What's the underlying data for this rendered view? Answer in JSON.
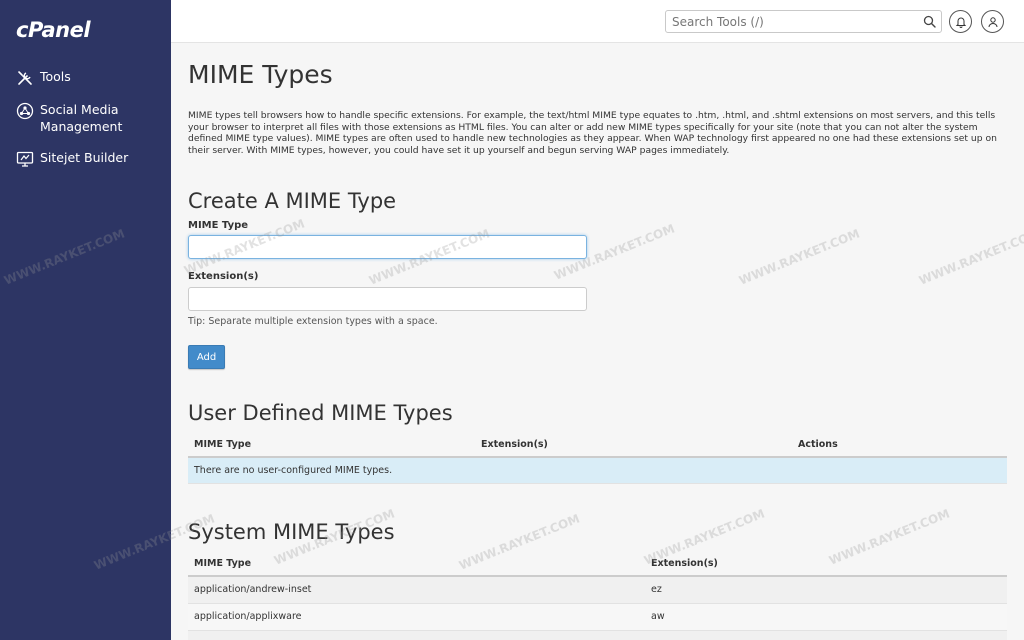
{
  "brand": {
    "logo_text": "cPanel"
  },
  "sidebar": {
    "items": [
      {
        "label": "Tools",
        "icon": "tools-icon"
      },
      {
        "label": "Social Media Management",
        "icon": "social-media-icon"
      },
      {
        "label": "Sitejet Builder",
        "icon": "sitejet-icon"
      }
    ]
  },
  "topbar": {
    "search_placeholder": "Search Tools (/)"
  },
  "page": {
    "title": "MIME Types",
    "description": "MIME types tell browsers how to handle specific extensions. For example, the text/html MIME type equates to .htm, .html, and .shtml extensions on most servers, and this tells your browser to interpret all files with those extensions as HTML files. You can alter or add new MIME types specifically for your site (note that you can not alter the system defined MIME type values). MIME types are often used to handle new technologies as they appear. When WAP technology first appeared no one had these extensions set up on their server. With MIME types, however, you could have set it up yourself and begun serving WAP pages immediately."
  },
  "create": {
    "heading": "Create A MIME Type",
    "mime_label": "MIME Type",
    "mime_value": "",
    "ext_label": "Extension(s)",
    "ext_value": "",
    "tip": "Tip: Separate multiple extension types with a space.",
    "add_label": "Add"
  },
  "user_defined": {
    "heading": "User Defined MIME Types",
    "columns": [
      "MIME Type",
      "Extension(s)",
      "Actions"
    ],
    "empty_message": "There are no user-configured MIME types."
  },
  "system": {
    "heading": "System MIME Types",
    "columns": [
      "MIME Type",
      "Extension(s)"
    ],
    "rows": [
      {
        "type": "application/andrew-inset",
        "ext": "ez"
      },
      {
        "type": "application/applixware",
        "ext": "aw"
      },
      {
        "type": "",
        "ext": ""
      }
    ]
  },
  "watermark": "WWW.RAYKET.COM"
}
